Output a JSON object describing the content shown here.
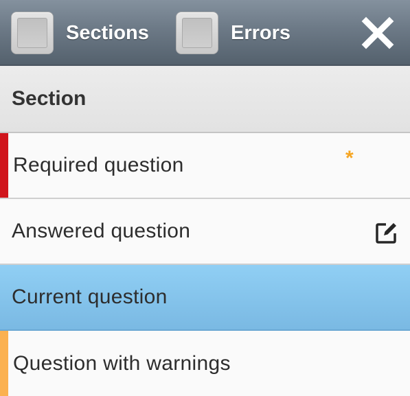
{
  "toolbar": {
    "sections_label": "Sections",
    "errors_label": "Errors",
    "sections_checked": false,
    "errors_checked": false,
    "close_icon": "close-icon"
  },
  "section": {
    "title": "Section"
  },
  "questions": [
    {
      "label": "Required question",
      "state": "required",
      "indicator_color": "#d0151c",
      "icon": "required-asterisk",
      "icon_text": "*",
      "icon_color": "#f6a623"
    },
    {
      "label": "Answered question",
      "state": "answered",
      "icon": "edit-icon"
    },
    {
      "label": "Current question",
      "state": "current",
      "highlight_color": "#87c6ef"
    },
    {
      "label": "Question with warnings",
      "state": "warning",
      "indicator_color": "#fbb150"
    }
  ]
}
